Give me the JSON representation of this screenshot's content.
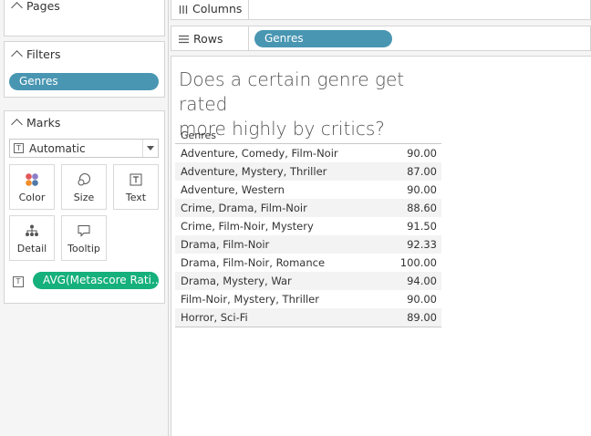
{
  "pages_card": {
    "title": "Pages"
  },
  "filters_card": {
    "title": "Filters",
    "pill": "Genres"
  },
  "marks_card": {
    "title": "Marks",
    "mark_type": "Automatic",
    "buttons": [
      "Color",
      "Size",
      "Text",
      "Detail",
      "Tooltip"
    ],
    "measure_pill": "AVG(Metascore Rati..."
  },
  "shelves": {
    "columns_label": "Columns",
    "rows_label": "Rows",
    "rows_pill": "Genres"
  },
  "colors": {
    "dimension_pill": "#4996b2",
    "measure_pill": "#15b07c"
  },
  "view": {
    "title_line1": "Does a certain genre get rated",
    "title_line2": "more highly by critics?",
    "column_header": "Genres",
    "rows": [
      {
        "genre": "Adventure, Comedy, Film-Noir",
        "value": "90.00"
      },
      {
        "genre": "Adventure, Mystery, Thriller",
        "value": "87.00"
      },
      {
        "genre": "Adventure, Western",
        "value": "90.00"
      },
      {
        "genre": "Crime, Drama, Film-Noir",
        "value": "88.60"
      },
      {
        "genre": "Crime, Film-Noir, Mystery",
        "value": "91.50"
      },
      {
        "genre": "Drama, Film-Noir",
        "value": "92.33"
      },
      {
        "genre": "Drama, Film-Noir, Romance",
        "value": "100.00"
      },
      {
        "genre": "Drama, Mystery, War",
        "value": "94.00"
      },
      {
        "genre": "Film-Noir, Mystery, Thriller",
        "value": "90.00"
      },
      {
        "genre": "Horror, Sci-Fi",
        "value": "89.00"
      }
    ]
  }
}
